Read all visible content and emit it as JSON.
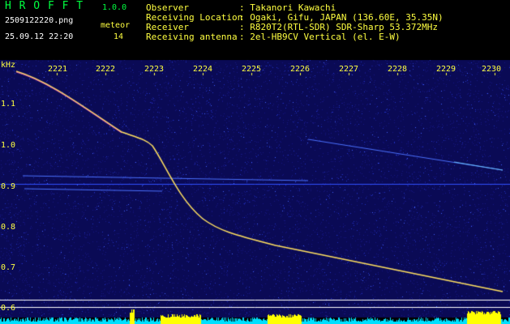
{
  "header": {
    "app_title": "H R O F F T",
    "version": "1.0.0",
    "filename": "2509122220.png",
    "mode_label": "meteor",
    "datetime": "25.09.12 22:20",
    "count": "14",
    "info": [
      {
        "label": "Observer",
        "value": ": Takanori Kawachi"
      },
      {
        "label": "Receiving Location",
        "value": ": Ogaki, Gifu, JAPAN (136.60E, 35.35N)"
      },
      {
        "label": "Receiver",
        "value": ": R820T2(RTL-SDR) SDR-Sharp 53.372MHz"
      },
      {
        "label": "Receiving antenna",
        "value": ": 2el-HB9CV Vertical (el. E-W)"
      }
    ]
  },
  "spectrogram": {
    "y_unit": "kHz",
    "y_ticks": [
      "1.1",
      "1.0",
      "0.9",
      "0.8",
      "0.7",
      "0.6"
    ],
    "x_ticks": [
      "2221",
      "2222",
      "2223",
      "2224",
      "2225",
      "2226",
      "2227",
      "2228",
      "2229",
      "2230"
    ],
    "colors": {
      "background": "#0a0a55",
      "trace": "#ffe060",
      "axis_text": "#ffff40",
      "baseline": "#00e0ff",
      "burst": "#ffff00"
    }
  }
}
